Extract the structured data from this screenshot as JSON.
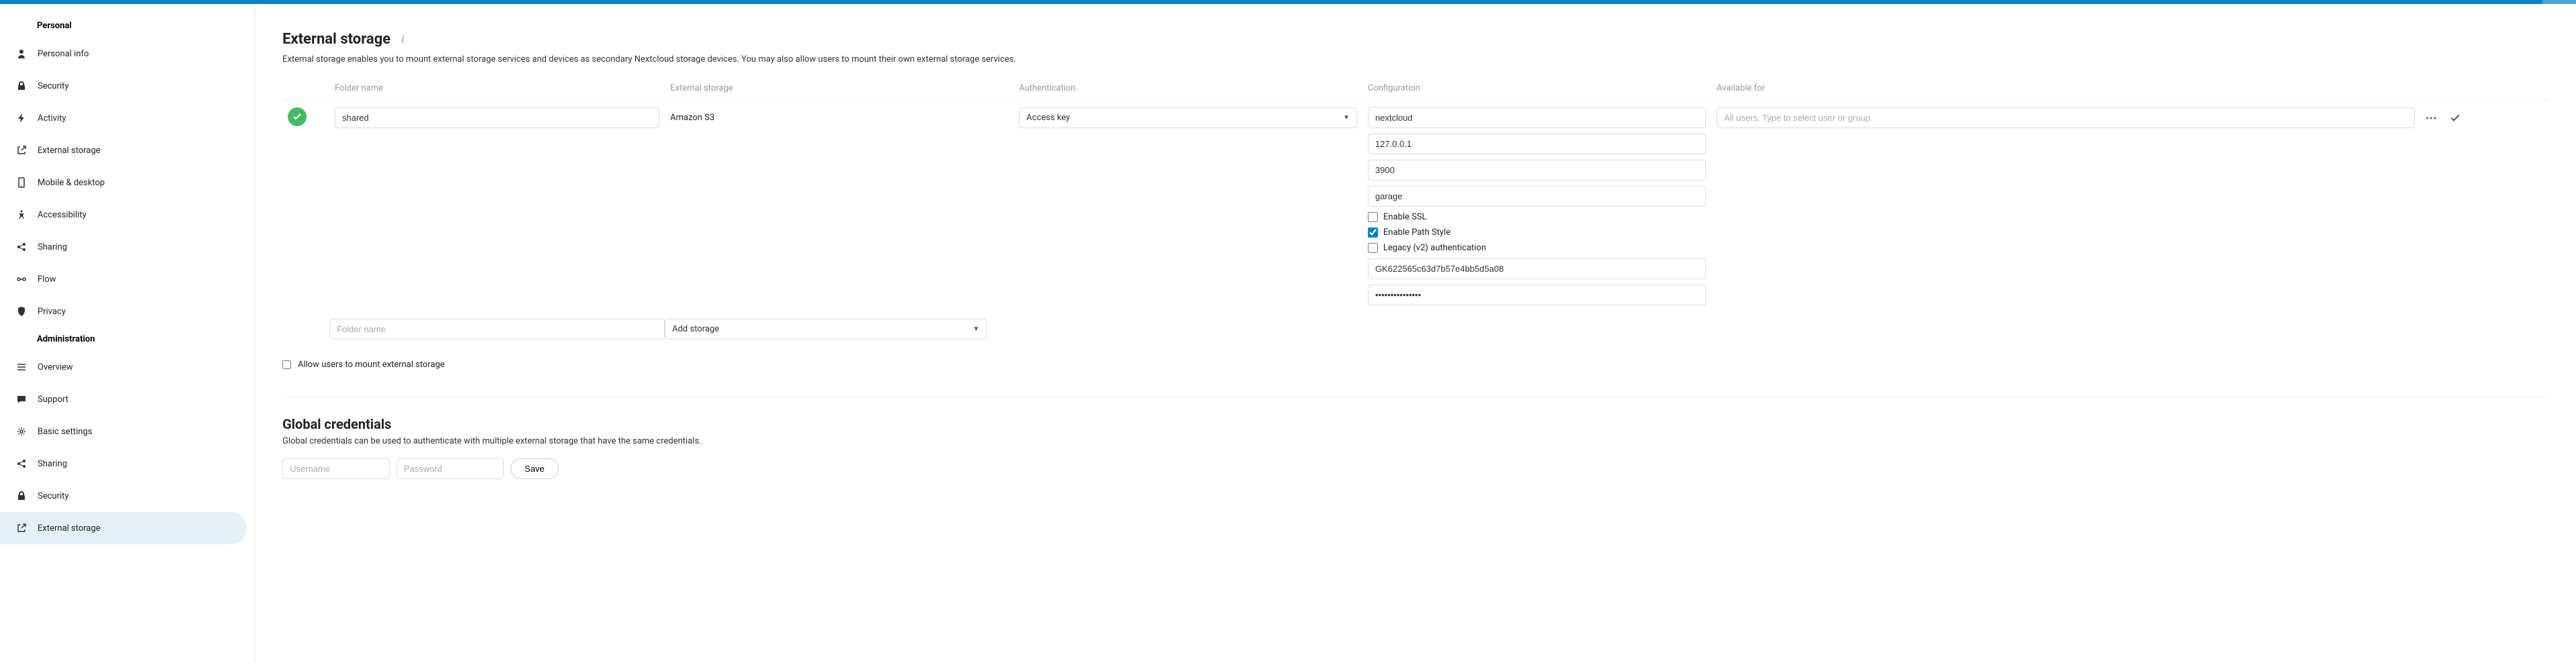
{
  "sidebar": {
    "personal_heading": "Personal",
    "admin_heading": "Administration",
    "personal": [
      {
        "label": "Personal info"
      },
      {
        "label": "Security"
      },
      {
        "label": "Activity"
      },
      {
        "label": "External storage"
      },
      {
        "label": "Mobile & desktop"
      },
      {
        "label": "Accessibility"
      },
      {
        "label": "Sharing"
      },
      {
        "label": "Flow"
      },
      {
        "label": "Privacy"
      }
    ],
    "admin": [
      {
        "label": "Overview"
      },
      {
        "label": "Support"
      },
      {
        "label": "Basic settings"
      },
      {
        "label": "Sharing"
      },
      {
        "label": "Security"
      },
      {
        "label": "External storage"
      }
    ]
  },
  "page": {
    "title": "External storage",
    "description": "External storage enables you to mount external storage services and devices as secondary Nextcloud storage devices. You may also allow users to mount their own external storage services."
  },
  "table": {
    "headers": {
      "folder": "Folder name",
      "external": "External storage",
      "auth": "Authentication",
      "conf": "Configuration",
      "avail": "Available for"
    },
    "row": {
      "folder": "shared",
      "external_label": "Amazon S3",
      "auth_selected": "Access key",
      "conf": {
        "bucket": "nextcloud",
        "host": "127.0.0.1",
        "port": "3900",
        "region": "garage",
        "enable_ssl": "Enable SSL",
        "enable_ssl_checked": false,
        "enable_path_style": "Enable Path Style",
        "enable_path_style_checked": true,
        "legacy_auth": "Legacy (v2) authentication",
        "legacy_auth_checked": false,
        "access_key": "GK622565c63d7b57e4bb5d5a08",
        "secret_key": "•••••••••••••••"
      },
      "avail_placeholder": "All users. Type to select user or group."
    },
    "add": {
      "folder_placeholder": "Folder name",
      "storage_placeholder": "Add storage"
    }
  },
  "allow_mount_label": "Allow users to mount external storage",
  "allow_mount_checked": false,
  "global_credentials": {
    "title": "Global credentials",
    "desc": "Global credentials can be used to authenticate with multiple external storage that have the same credentials.",
    "username_placeholder": "Username",
    "password_placeholder": "Password",
    "save": "Save"
  }
}
